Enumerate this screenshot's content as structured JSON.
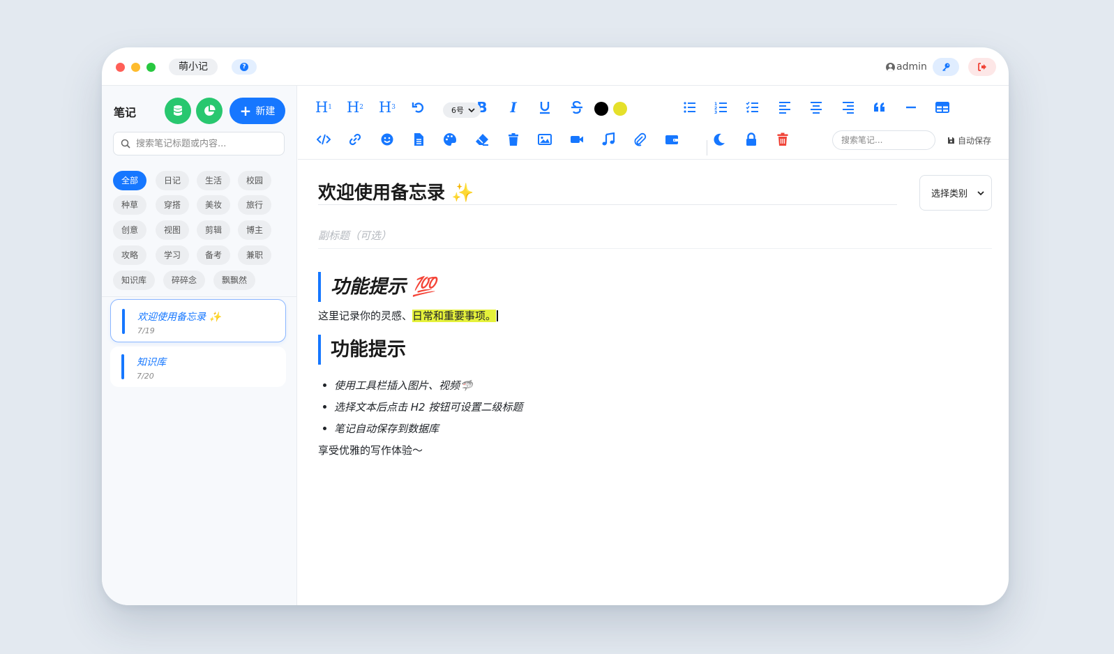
{
  "app": {
    "name": "萌小记",
    "user": "admin"
  },
  "sidebar": {
    "title": "笔记",
    "new_button": "新建",
    "search_placeholder": "搜索笔记标题或内容...",
    "tags": [
      "全部",
      "日记",
      "生活",
      "校园",
      "种草",
      "穿搭",
      "美妆",
      "旅行",
      "创意",
      "视图",
      "剪辑",
      "博主",
      "攻略",
      "学习",
      "备考",
      "兼职",
      "知识库",
      "碎碎念",
      "飘飘然"
    ],
    "active_tag": "全部",
    "notes": [
      {
        "title": "欢迎使用备忘录 ✨",
        "date": "7/19"
      },
      {
        "title": "知识库",
        "date": "7/20"
      }
    ]
  },
  "toolbar": {
    "font_size": "6号",
    "search_placeholder": "搜索笔记...",
    "autosave_label": "自动保存",
    "text_color": "#000000",
    "highlight_color": "#e5e02a"
  },
  "editor": {
    "title": "欢迎使用备忘录 ✨",
    "category_placeholder": "选择类别",
    "subtitle_placeholder": "副标题（可选）",
    "heading1": "功能提示 💯",
    "paragraph_plain": "这里记录你的灵感、",
    "paragraph_highlight": "日常和重要事项。",
    "heading2": "功能提示",
    "bullets": [
      "使用工具栏插入图片、视频🦈",
      "选择文本后点击 H2 按钮可设置二级标题",
      "笔记自动保存到数据库"
    ],
    "closing": "享受优雅的写作体验～"
  },
  "colors": {
    "accent": "#1677ff",
    "success": "#28c76f",
    "danger": "#f04438"
  }
}
